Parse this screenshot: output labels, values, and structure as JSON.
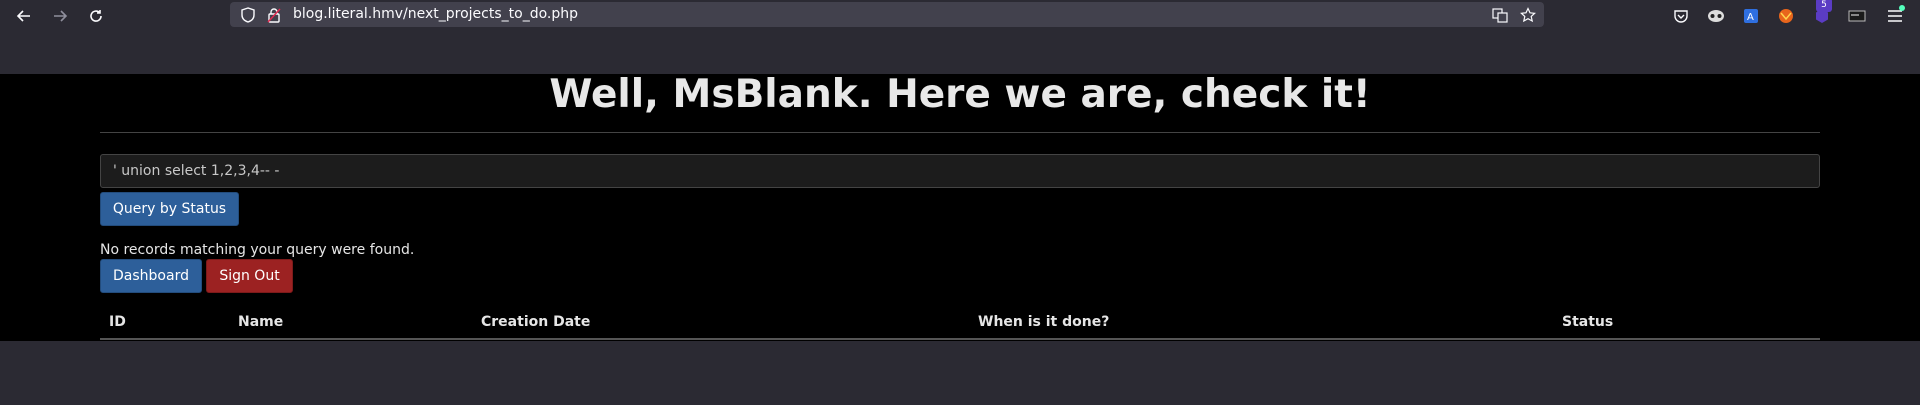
{
  "browser": {
    "url": "blog.literal.hmv/next_projects_to_do.php",
    "badge_count": "5"
  },
  "page": {
    "heading_prefix": "Well, ",
    "heading_user": "MsBlank",
    "heading_suffix": ". Here we are, check it!",
    "query_value": "' union select 1,2,3,4-- -",
    "query_button": "Query by Status",
    "message": "No records matching your query were found.",
    "dashboard_button": "Dashboard",
    "signout_button": "Sign Out",
    "table_headers": [
      "ID",
      "Name",
      "Creation Date",
      "When is it done?",
      "Status"
    ]
  },
  "colors": {
    "primary_button": "#2d5f9a",
    "danger_button": "#9c2222",
    "page_bg": "#000000",
    "chrome_bg": "#2b2a33"
  }
}
